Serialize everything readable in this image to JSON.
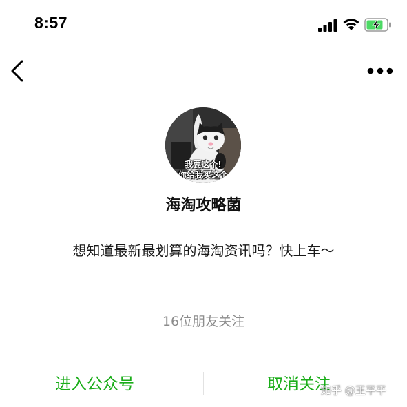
{
  "status_bar": {
    "time": "8:57",
    "signal_icon": "signal-bars-icon",
    "wifi_icon": "wifi-icon",
    "battery_icon": "battery-charging-icon",
    "battery_color": "#4cd964"
  },
  "nav": {
    "back_icon": "back-chevron-icon",
    "more_icon": "more-dots-icon"
  },
  "profile": {
    "avatar_caption_line1": "我要这个!",
    "avatar_caption_line2": "你给我买这个",
    "name": "海淘攻略菌",
    "description": "想知道最新最划算的海淘资讯吗？快上车～",
    "followers": "16位朋友关注"
  },
  "actions": {
    "enter_label": "进入公众号",
    "unfollow_label": "取消关注",
    "accent_color": "#1aad19"
  },
  "watermark": "知乎 @王平平"
}
